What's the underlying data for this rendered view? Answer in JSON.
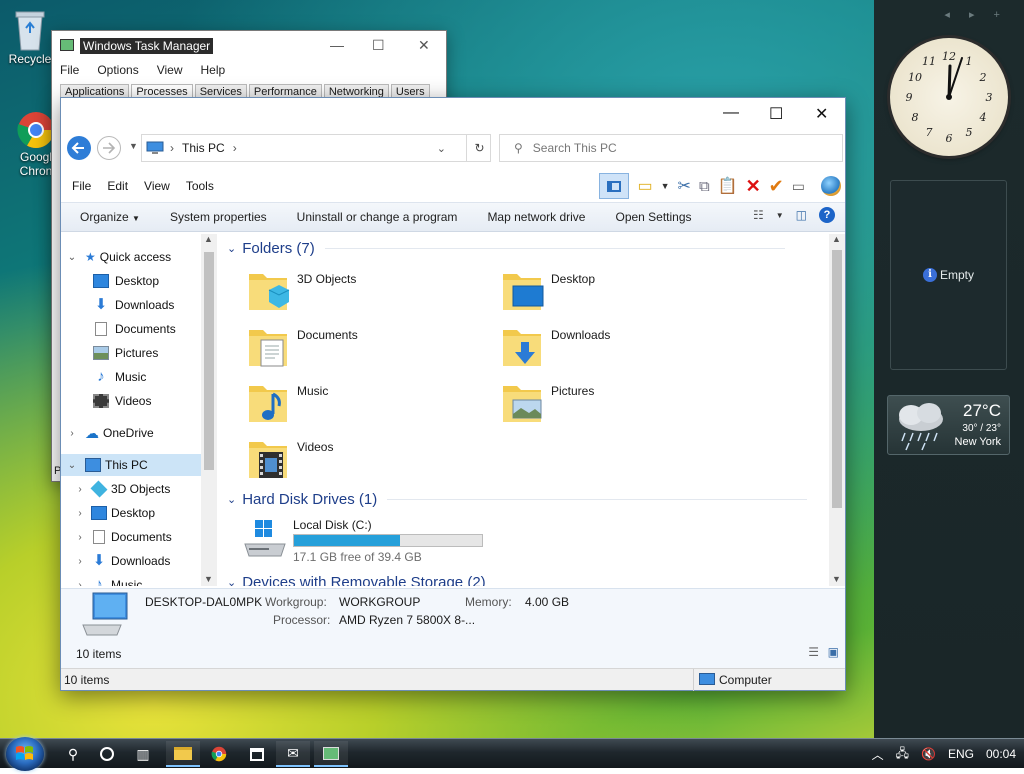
{
  "desktop": {
    "icons": [
      {
        "label": "Recycle",
        "icon": "recycle-bin-icon"
      },
      {
        "label": "Googl\nChron",
        "icon": "chrome-icon"
      }
    ]
  },
  "gadgets": {
    "clock_time": "12:04",
    "slideshow": {
      "label": "Empty"
    },
    "weather": {
      "temp": "27°C",
      "range": "30° / 23°",
      "city": "New York"
    }
  },
  "task_manager": {
    "title": "Windows Task Manager",
    "menu": [
      "File",
      "Options",
      "View",
      "Help"
    ],
    "tabs": [
      "Applications",
      "Processes",
      "Services",
      "Performance",
      "Networking",
      "Users"
    ],
    "active_tab": "Processes",
    "status_fragment": "P"
  },
  "explorer": {
    "address": {
      "location": "This PC"
    },
    "search": {
      "placeholder": "Search This PC"
    },
    "menu": [
      "File",
      "Edit",
      "View",
      "Tools"
    ],
    "commands": [
      "Organize",
      "System properties",
      "Uninstall or change a program",
      "Map network drive",
      "Open Settings"
    ],
    "nav": {
      "quick_access": "Quick access",
      "quick_items": [
        "Desktop",
        "Downloads",
        "Documents",
        "Pictures",
        "Music",
        "Videos"
      ],
      "onedrive": "OneDrive",
      "this_pc": "This PC",
      "pc_items": [
        "3D Objects",
        "Desktop",
        "Documents",
        "Downloads",
        "Music"
      ]
    },
    "groups": {
      "folders_header": "Folders (7)",
      "folders": [
        "3D Objects",
        "Desktop",
        "Documents",
        "Downloads",
        "Music",
        "Pictures",
        "Videos"
      ],
      "drives_header": "Hard Disk Drives (1)",
      "drive": {
        "name": "Local Disk (C:)",
        "free": "17.1 GB free of 39.4 GB",
        "used_fraction": 0.566
      },
      "removable_header": "Devices with Removable Storage (2)"
    },
    "details": {
      "computer_name": "DESKTOP-DAL0MPK",
      "workgroup_label": "Workgroup:",
      "workgroup": "WORKGROUP",
      "memory_label": "Memory:",
      "memory": "4.00 GB",
      "processor_label": "Processor:",
      "processor": "AMD Ryzen 7 5800X 8-..."
    },
    "status_items": "10 items",
    "status_items_2": "10 items",
    "status_zone": "Computer"
  },
  "taskbar": {
    "tray": {
      "lang": "ENG",
      "time": "00:04"
    }
  }
}
